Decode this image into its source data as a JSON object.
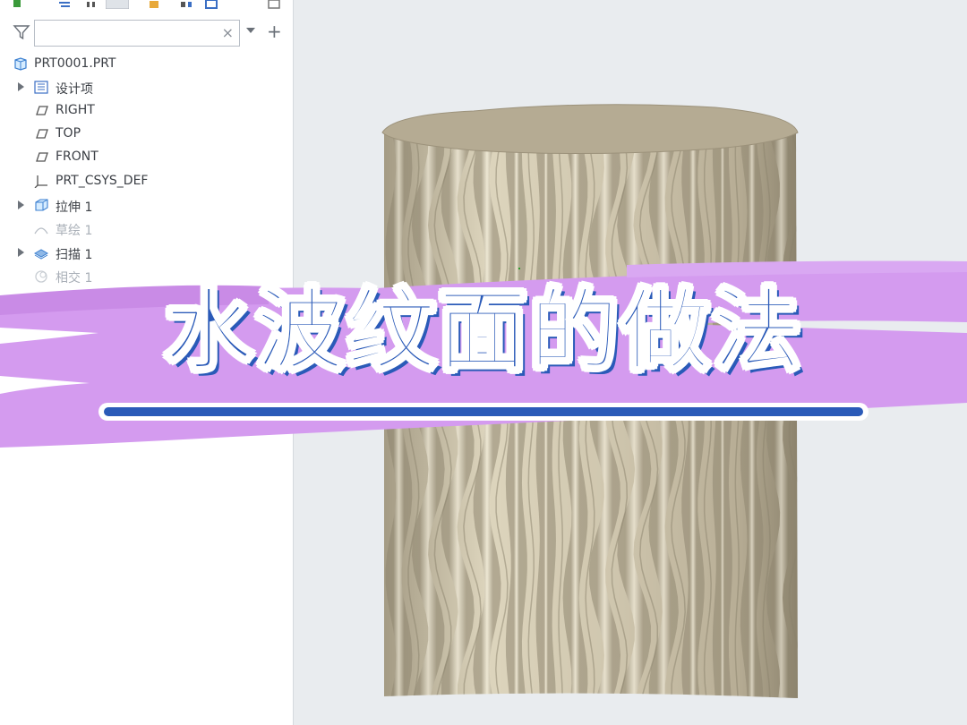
{
  "search": {
    "value": "",
    "placeholder": ""
  },
  "tree": {
    "root": "PRT0001.PRT",
    "items": [
      {
        "label": "设计项",
        "icon": "design-items-icon",
        "expandable": true,
        "dim": false
      },
      {
        "label": "RIGHT",
        "icon": "datum-plane-icon",
        "expandable": false,
        "dim": false
      },
      {
        "label": "TOP",
        "icon": "datum-plane-icon",
        "expandable": false,
        "dim": false
      },
      {
        "label": "FRONT",
        "icon": "datum-plane-icon",
        "expandable": false,
        "dim": false
      },
      {
        "label": "PRT_CSYS_DEF",
        "icon": "coordinate-system-icon",
        "expandable": false,
        "dim": false
      },
      {
        "label": "拉伸 1",
        "icon": "extrude-icon",
        "expandable": true,
        "dim": false
      },
      {
        "label": "草绘 1",
        "icon": "sketch-icon",
        "expandable": false,
        "dim": true
      },
      {
        "label": "扫描 1",
        "icon": "sweep-icon",
        "expandable": true,
        "dim": false
      },
      {
        "label": "相交 1",
        "icon": "intersect-icon",
        "expandable": false,
        "dim": true
      }
    ]
  },
  "overlay": {
    "title": "水波纹面的做法"
  },
  "colors": {
    "brush": "#d39cf0",
    "title": "#2a5ab8",
    "model_base": "#c9c0a8",
    "model_top": "#b3a992"
  }
}
